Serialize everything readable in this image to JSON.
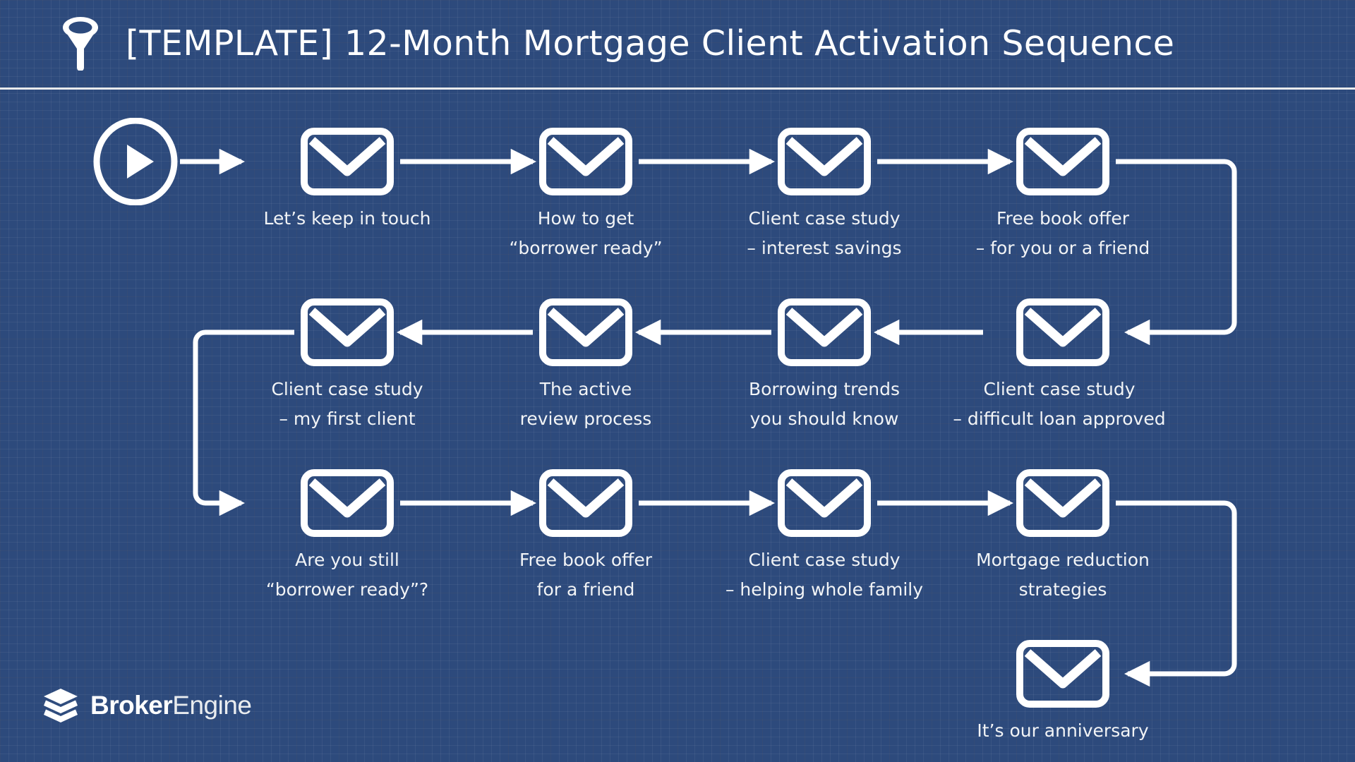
{
  "header": {
    "icon": "funnel-icon",
    "title": "[TEMPLATE] 12-Month Mortgage Client Activation Sequence",
    "divider_color": "#e8eaec"
  },
  "theme": {
    "background": "#2d4a7c",
    "grid_line": "#24406f",
    "stroke": "#ffffff",
    "label_text": "#f2f4f6"
  },
  "footer": {
    "logo_mark": "stacked-layers-icon",
    "brand_bold": "Broker",
    "brand_light": "Engine"
  },
  "diagram": {
    "type": "flowchart",
    "start_node": {
      "icon": "play-circle-icon",
      "name": "sequence-start"
    },
    "rows": [
      {
        "row": 1,
        "nodes": [
          {
            "icon": "envelope-icon",
            "line1": "Let’s keep in touch",
            "line2": ""
          },
          {
            "icon": "envelope-icon",
            "line1": "How to get",
            "line2": "“borrower ready”"
          },
          {
            "icon": "envelope-icon",
            "line1": "Client case study",
            "line2": "– interest savings"
          },
          {
            "icon": "envelope-icon",
            "line1": "Free book offer",
            "line2": "– for you or a friend"
          }
        ]
      },
      {
        "row": 2,
        "nodes": [
          {
            "icon": "envelope-icon",
            "line1": "Client case study",
            "line2": "– my first client"
          },
          {
            "icon": "envelope-icon",
            "line1": "The active",
            "line2": "review process"
          },
          {
            "icon": "envelope-icon",
            "line1": "Borrowing trends",
            "line2": "you should know"
          },
          {
            "icon": "envelope-icon",
            "line1": "Client case study",
            "line2": "– difficult loan approved"
          }
        ]
      },
      {
        "row": 3,
        "nodes": [
          {
            "icon": "envelope-icon",
            "line1": "Are you still",
            "line2": "“borrower ready”?"
          },
          {
            "icon": "envelope-icon",
            "line1": "Free book offer",
            "line2": "for a friend"
          },
          {
            "icon": "envelope-icon",
            "line1": "Client case study",
            "line2": "– helping whole family"
          },
          {
            "icon": "envelope-icon",
            "line1": "Mortgage reduction",
            "line2": "strategies"
          }
        ]
      },
      {
        "row": 4,
        "nodes": [
          {
            "icon": "envelope-icon",
            "line1": "It’s our anniversary",
            "line2": ""
          }
        ]
      }
    ]
  }
}
